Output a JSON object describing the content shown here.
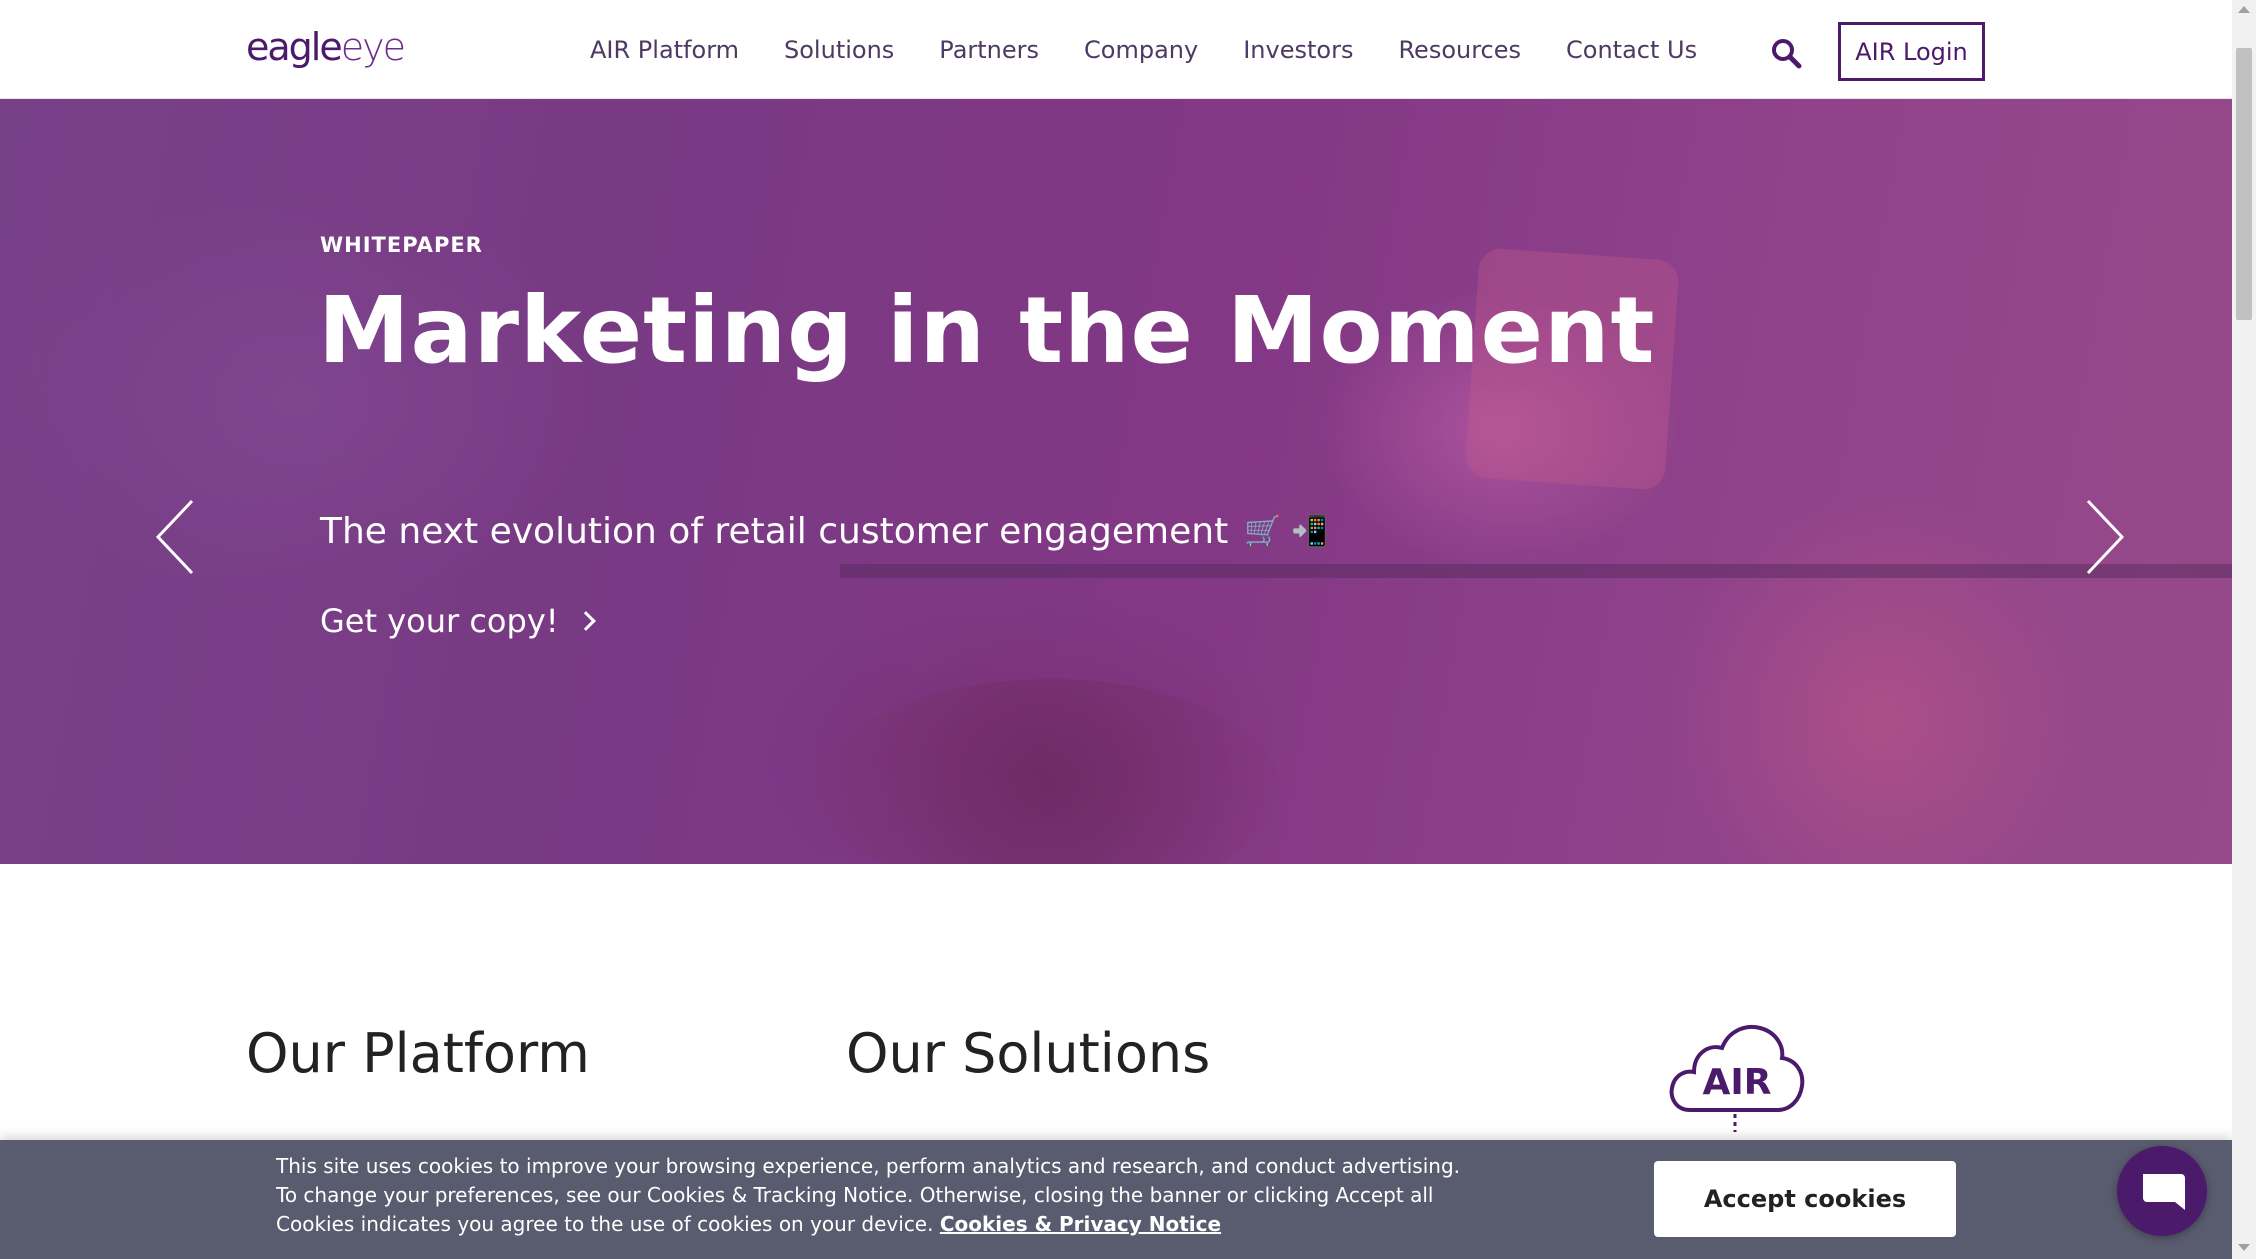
{
  "header": {
    "logo": {
      "part1": "eagle",
      "part2": "eye"
    },
    "nav": [
      "AIR Platform",
      "Solutions",
      "Partners",
      "Company",
      "Investors",
      "Resources",
      "Contact Us"
    ],
    "search_icon": "search-icon",
    "login_label": "AIR Login"
  },
  "hero": {
    "eyebrow": "WHITEPAPER",
    "title": "Marketing in the Moment",
    "subtitle": "The next evolution of retail customer engagement",
    "subtitle_emoji": "🛒 📲",
    "cta_label": "Get your copy!",
    "slide_count": 5,
    "active_slide": 1
  },
  "sections": {
    "platform_title": "Our Platform",
    "solutions_title": "Our Solutions",
    "air_logo_text": "AIR"
  },
  "cookie_banner": {
    "text": "This site uses cookies to improve your browsing experience, perform analytics and research, and conduct advertising. To change your preferences, see our Cookies & Tracking Notice. Otherwise, closing the banner or clicking Accept all Cookies indicates you agree to the use of cookies on your device.",
    "link_label": "Cookies & Privacy Notice",
    "accept_label": "Accept cookies"
  },
  "colors": {
    "brand_purple": "#4b1a6b",
    "nav_text": "#4d3a63",
    "banner_bg": "#595b6e"
  }
}
